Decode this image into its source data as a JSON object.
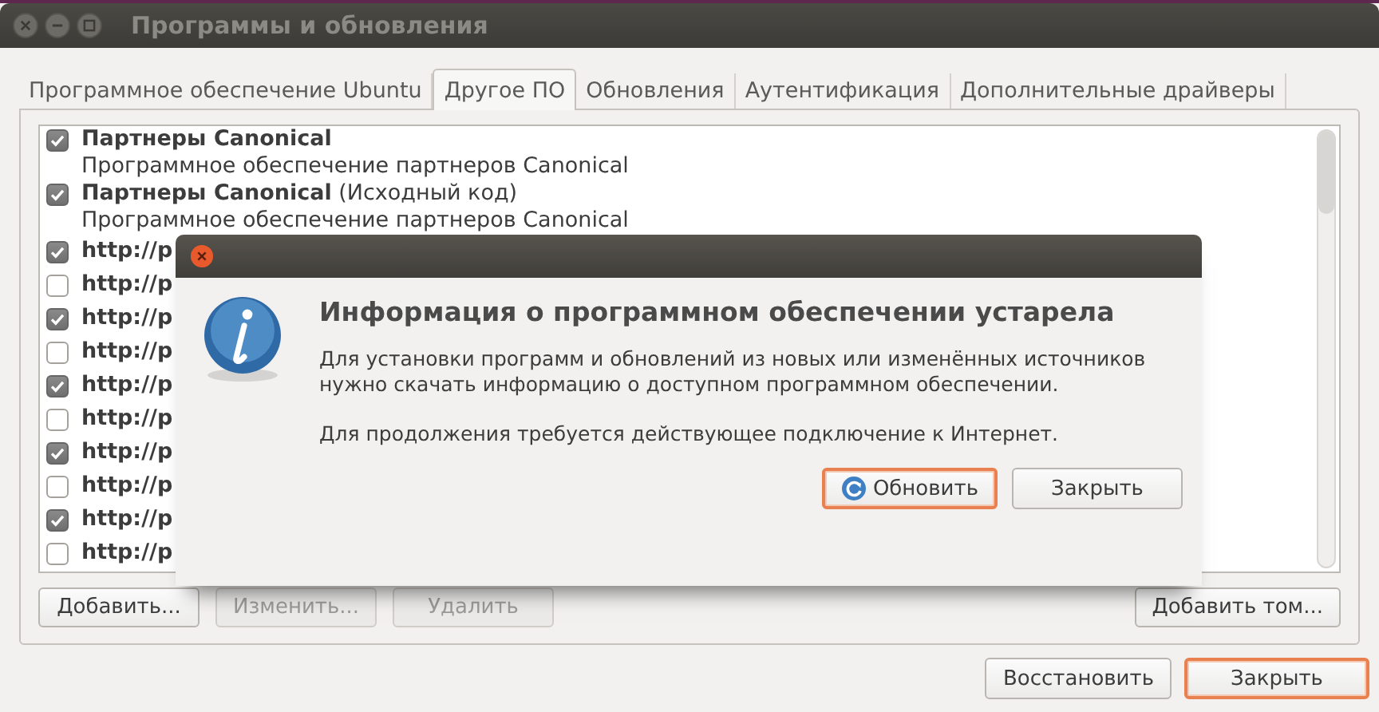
{
  "window": {
    "title": "Программы и обновления"
  },
  "tabs": [
    {
      "label": "Программное обеспечение Ubuntu",
      "selected": false
    },
    {
      "label": "Другое ПО",
      "selected": true
    },
    {
      "label": "Обновления",
      "selected": false
    },
    {
      "label": "Аутентификация",
      "selected": false
    },
    {
      "label": "Дополнительные драйверы",
      "selected": false
    }
  ],
  "sources": [
    {
      "name": "Партнеры Canonical",
      "description": "Программное обеспечение партнеров Canonical",
      "checked": true
    },
    {
      "name": "Партнеры Canonical",
      "suffix": "(Исходный код)",
      "description": "Программное обеспечение партнеров Canonical",
      "checked": true
    },
    {
      "name": "http://p",
      "checked": true
    },
    {
      "name": "http://p",
      "checked": false
    },
    {
      "name": "http://p",
      "checked": true
    },
    {
      "name": "http://p",
      "checked": false
    },
    {
      "name": "http://p",
      "checked": true
    },
    {
      "name": "http://p",
      "checked": false
    },
    {
      "name": "http://p",
      "checked": true
    },
    {
      "name": "http://p",
      "checked": false
    },
    {
      "name": "http://p",
      "checked": true
    },
    {
      "name": "http://p",
      "checked": false
    }
  ],
  "source_buttons": [
    {
      "label": "Добавить...",
      "disabled": false
    },
    {
      "label": "Изменить...",
      "disabled": true
    },
    {
      "label": "Удалить",
      "disabled": true
    }
  ],
  "add_volume_button": {
    "label": "Добавить том...",
    "disabled": false
  },
  "footer_buttons": [
    {
      "label": "Восстановить",
      "default": false
    },
    {
      "label": "Закрыть",
      "default": true
    }
  ],
  "dialog": {
    "heading": "Информация о программном обеспечении устарела",
    "paragraphs": [
      "Для установки программ и обновлений из новых или изменённых источников нужно скачать информацию о доступном программном обеспечении.",
      "Для продолжения требуется действующее подключение к Интернет."
    ],
    "buttons": [
      {
        "label": "Обновить",
        "kind": "refresh",
        "focused": true
      },
      {
        "label": "Закрыть",
        "kind": "plain",
        "focused": false
      }
    ]
  }
}
